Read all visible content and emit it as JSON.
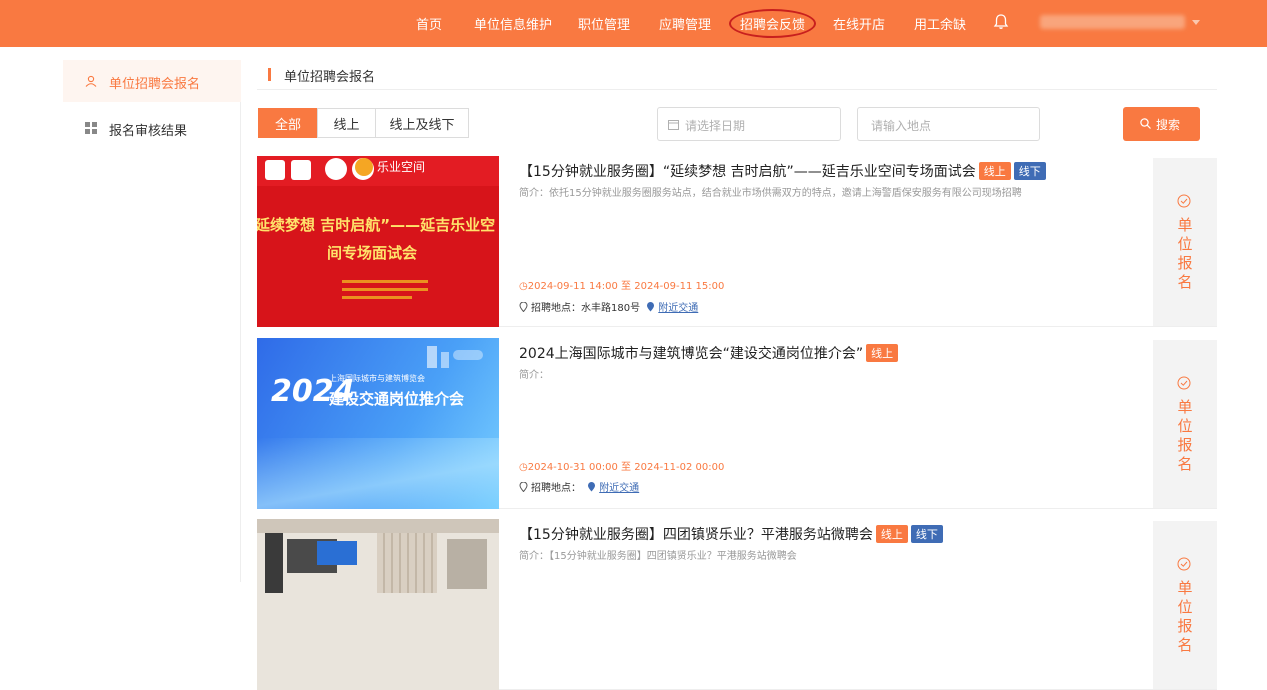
{
  "nav": {
    "items": [
      {
        "label": "首页"
      },
      {
        "label": "单位信息维护"
      },
      {
        "label": "职位管理"
      },
      {
        "label": "应聘管理"
      },
      {
        "label": "招聘会反馈"
      },
      {
        "label": "在线开店"
      },
      {
        "label": "用工余缺"
      }
    ],
    "active_index": 4,
    "bell_icon": "bell-icon"
  },
  "sidebar": {
    "items": [
      {
        "label": "单位招聘会报名",
        "icon": "user-icon",
        "active": true
      },
      {
        "label": "报名审核结果",
        "icon": "grid-icon",
        "active": false
      }
    ]
  },
  "breadcrumb": {
    "title": "单位招聘会报名"
  },
  "filters": {
    "tabs": [
      {
        "label": "全部",
        "active": true
      },
      {
        "label": "线上",
        "active": false
      },
      {
        "label": "线上及线下",
        "active": false
      }
    ],
    "date_placeholder": "请选择日期",
    "location_placeholder": "请输入地点",
    "search_label": "搜索"
  },
  "fairs": [
    {
      "title": "【15分钟就业服务圈】“延续梦想 吉时启航”——延吉乐业空间专场面试会",
      "tags": [
        "线上",
        "线下"
      ],
      "intro": "简介：依托15分钟就业服务圈服务站点，结合就业市场供需双方的特点，邀请上海警盾保安服务有限公司现场招聘",
      "time_start": "2024-09-11 14:00",
      "time_sep": "至",
      "time_end": "2024-09-11 15:00",
      "location_label": "招聘地点：",
      "location": "水丰路180号",
      "traffic_label": "附近交通",
      "apply_label": "单位报名",
      "poster": {
        "logo_text": "乐业空间",
        "headline_1": "延续梦想 吉时启航”——延吉乐业空",
        "headline_2": "间专场面试会"
      }
    },
    {
      "title": "2024上海国际城市与建筑博览会“建设交通岗位推介会”",
      "tags": [
        "线上"
      ],
      "intro": "简介：",
      "time_start": "2024-10-31 00:00",
      "time_sep": "至",
      "time_end": "2024-11-02 00:00",
      "location_label": "招聘地点：",
      "location": "",
      "traffic_label": "附近交通",
      "apply_label": "单位报名",
      "poster": {
        "year": "2024",
        "subtitle": "上海国际城市与建筑博览会",
        "headline": "建设交通岗位推介会"
      }
    },
    {
      "title": "【15分钟就业服务圈】四团镇贤乐业？平港服务站微聘会",
      "tags": [
        "线上",
        "线下"
      ],
      "intro": "简介：【15分钟就业服务圈】四团镇贤乐业？平港服务站微聘会",
      "apply_label": "单位报名"
    }
  ],
  "colors": {
    "accent": "#f97941",
    "offline_tag": "#3f6cb5",
    "highlight_ring": "#c8201e"
  }
}
